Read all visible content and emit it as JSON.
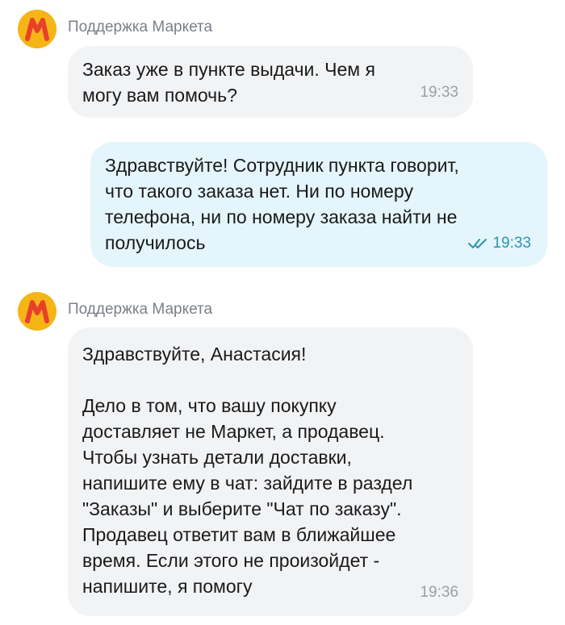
{
  "colors": {
    "avatar_bg": "#f5b517",
    "avatar_letter": "#e8412b",
    "incoming_bubble": "#f2f3f5",
    "outgoing_bubble": "#e4f5fb",
    "read_status": "#2a96b2"
  },
  "messages": [
    {
      "sender": "Поддержка Маркета",
      "avatar_icon": "yandex-market-m-logo",
      "text": "Заказ уже в пункте выдачи. Чем я\nмогу вам помочь?",
      "time": "19:33"
    },
    {
      "text": "Здравствуйте! Сотрудник пункта говорит,\nчто такого заказа нет. Ни по номеру\nтелефона, ни по номеру заказа найти не\nполучилось",
      "time": "19:33",
      "status_icon": "double-check-icon"
    },
    {
      "sender": "Поддержка Маркета",
      "avatar_icon": "yandex-market-m-logo",
      "text": "Здравствуйте, Анастасия!\n\nДело в том, что вашу покупку\nдоставляет не Маркет, а продавец.\nЧтобы узнать детали доставки,\nнапишите ему в чат: зайдите в раздел\n\"Заказы\" и выберите \"Чат по заказу\".\nПродавец ответит вам в ближайшее\nвремя. Если этого не произойдет -\nнапишите, я помогу",
      "time": "19:36"
    }
  ]
}
